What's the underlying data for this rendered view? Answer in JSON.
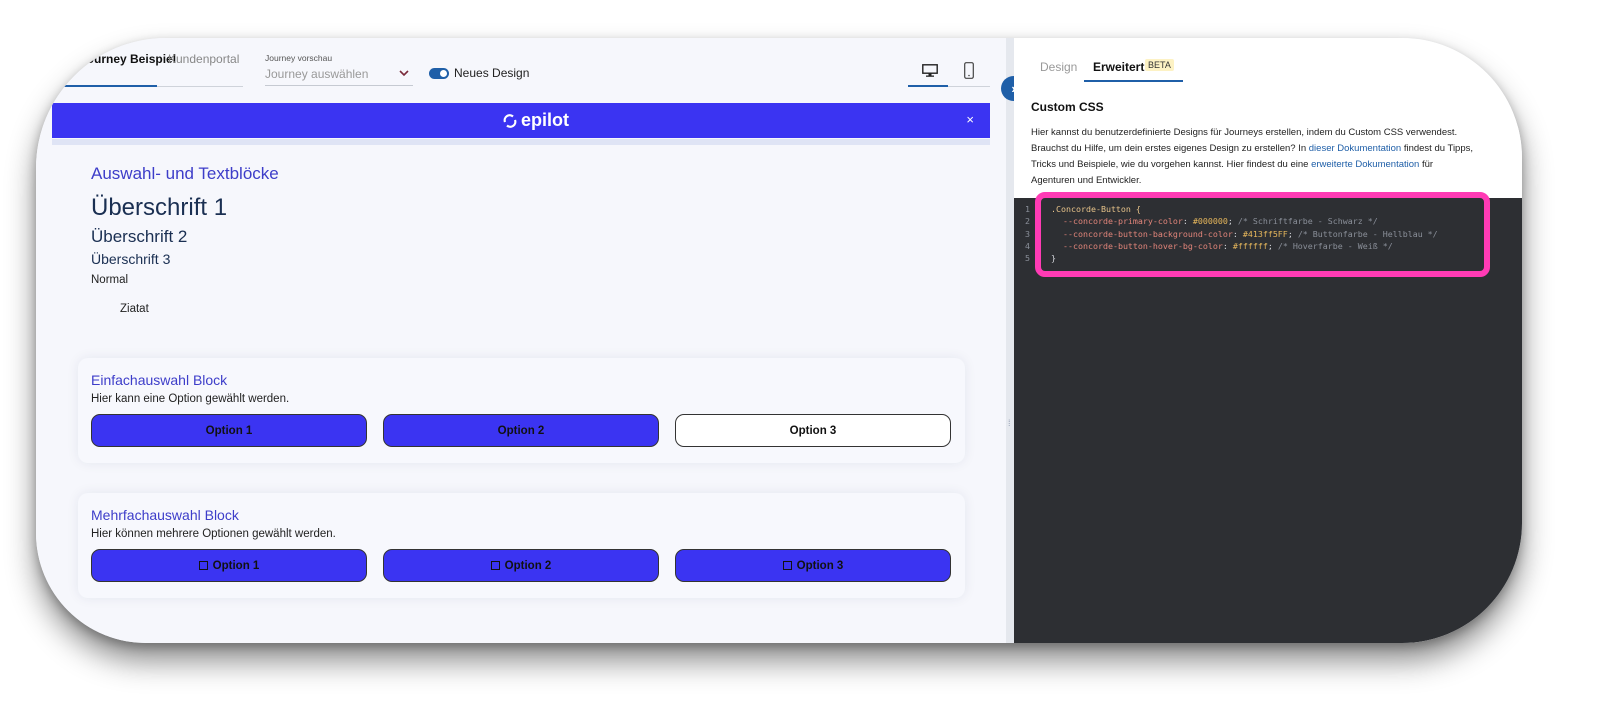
{
  "left": {
    "tabs": [
      {
        "label": "Journey Beispiel",
        "active": true
      },
      {
        "label": "Kundenportal",
        "active": false
      }
    ],
    "journey_preview": {
      "label": "Journey vorschau",
      "placeholder": "Journey auswählen"
    },
    "toggle": {
      "label": "Neues Design",
      "on": true
    },
    "device_icons": [
      "desktop-icon",
      "mobile-icon"
    ],
    "banner": {
      "logo_text": "epilot",
      "close": "×",
      "color": "#3b34f2"
    },
    "content": {
      "section_title": "Auswahl- und Textblöcke",
      "h1": "Überschrift 1",
      "h2": "Überschrift 2",
      "h3": "Überschrift 3",
      "normal": "Normal",
      "quote": "Ziatat"
    },
    "single_block": {
      "title": "Einfachauswahl Block",
      "description": "Hier kann eine Option gewählt werden.",
      "options": [
        "Option 1",
        "Option 2",
        "Option 3"
      ]
    },
    "multi_block": {
      "title": "Mehrfachauswahl Block",
      "description": "Hier können mehrere Optionen gewählt werden.",
      "options": [
        "Option 1",
        "Option 2",
        "Option 3"
      ]
    }
  },
  "right": {
    "tabs": [
      {
        "label": "Design",
        "active": false
      },
      {
        "label": "Erweitert",
        "active": true,
        "badge": "BETA"
      }
    ],
    "title": "Custom CSS",
    "description": {
      "line1": "Hier kannst du benutzerdefinierte Designs für Journeys erstellen, indem du Custom CSS verwendest.",
      "line2_a": "Brauchst du Hilfe, um dein erstes eigenes Design zu erstellen? In ",
      "link1": "dieser Dokumentation",
      "line2_b": " findest du Tipps,",
      "line3_a": "Tricks und Beispiele, wie du vorgehen kannst. Hier findest du eine ",
      "link2": "erweiterte Dokumentation",
      "line3_b": " für",
      "line4": "Agenturen und Entwickler."
    },
    "code": {
      "line_numbers": [
        "1",
        "2",
        "3",
        "4",
        "5"
      ],
      "l1_selector": ".Concorde-Button {",
      "l2_prop": "--concorde-primary-color",
      "l2_val": "#000000",
      "l2_cmt": "/* Schriftfarbe - Schwarz */",
      "l3_prop": "--concorde-button-background-color",
      "l3_val": "#413ff5FF",
      "l3_cmt": "/* Buttonfarbe - Hellblau */",
      "l4_prop": "--concorde-button-hover-bg-color",
      "l4_val": "#ffffff",
      "l4_cmt": "/* Hoverfarbe - Weiß */",
      "l5": "}"
    },
    "highlight_color": "#ff3bb5"
  }
}
